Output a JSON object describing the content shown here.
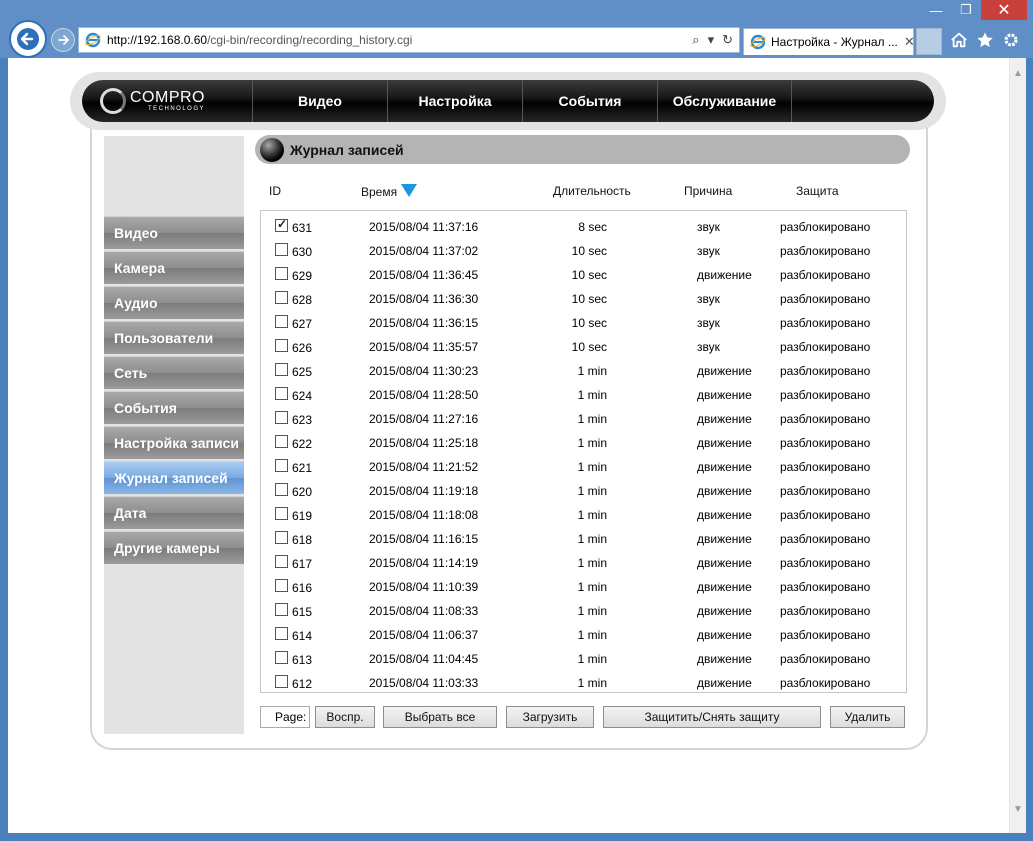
{
  "browser": {
    "url_host": "http://192.168.0.60",
    "url_path": "/cgi-bin/recording/recording_history.cgi",
    "tab_title": "Настройка - Журнал ...",
    "minimize": "—",
    "restore": "❐",
    "close": "✕",
    "tab_close": "✕"
  },
  "brand": {
    "name": "COMPRO",
    "sub": "TECHNOLOGY"
  },
  "topnav": [
    "Видео",
    "Настройка",
    "События",
    "Обслуживание"
  ],
  "sidebar": {
    "items": [
      {
        "label": "Видео",
        "active": false
      },
      {
        "label": "Камера",
        "active": false
      },
      {
        "label": "Аудио",
        "active": false
      },
      {
        "label": "Пользователи",
        "active": false
      },
      {
        "label": "Сеть",
        "active": false
      },
      {
        "label": "События",
        "active": false
      },
      {
        "label": "Настройка записи",
        "active": false
      },
      {
        "label": "Журнал записей",
        "active": true
      },
      {
        "label": "Дата",
        "active": false
      },
      {
        "label": "Другие камеры",
        "active": false
      }
    ]
  },
  "main": {
    "title": "Журнал записей",
    "columns": {
      "id": "ID",
      "time": "Время",
      "duration": "Длительность",
      "reason": "Причина",
      "protection": "Защита"
    },
    "rows": [
      {
        "checked": true,
        "id": "631",
        "time": "2015/08/04 11:37:16",
        "duration": "8 sec",
        "reason": "звук",
        "protection": "разблокировано"
      },
      {
        "checked": false,
        "id": "630",
        "time": "2015/08/04 11:37:02",
        "duration": "10 sec",
        "reason": "звук",
        "protection": "разблокировано"
      },
      {
        "checked": false,
        "id": "629",
        "time": "2015/08/04 11:36:45",
        "duration": "10 sec",
        "reason": "движение",
        "protection": "разблокировано"
      },
      {
        "checked": false,
        "id": "628",
        "time": "2015/08/04 11:36:30",
        "duration": "10 sec",
        "reason": "звук",
        "protection": "разблокировано"
      },
      {
        "checked": false,
        "id": "627",
        "time": "2015/08/04 11:36:15",
        "duration": "10 sec",
        "reason": "звук",
        "protection": "разблокировано"
      },
      {
        "checked": false,
        "id": "626",
        "time": "2015/08/04 11:35:57",
        "duration": "10 sec",
        "reason": "звук",
        "protection": "разблокировано"
      },
      {
        "checked": false,
        "id": "625",
        "time": "2015/08/04 11:30:23",
        "duration": "1 min",
        "reason": "движение",
        "protection": "разблокировано"
      },
      {
        "checked": false,
        "id": "624",
        "time": "2015/08/04 11:28:50",
        "duration": "1 min",
        "reason": "движение",
        "protection": "разблокировано"
      },
      {
        "checked": false,
        "id": "623",
        "time": "2015/08/04 11:27:16",
        "duration": "1 min",
        "reason": "движение",
        "protection": "разблокировано"
      },
      {
        "checked": false,
        "id": "622",
        "time": "2015/08/04 11:25:18",
        "duration": "1 min",
        "reason": "движение",
        "protection": "разблокировано"
      },
      {
        "checked": false,
        "id": "621",
        "time": "2015/08/04 11:21:52",
        "duration": "1 min",
        "reason": "движение",
        "protection": "разблокировано"
      },
      {
        "checked": false,
        "id": "620",
        "time": "2015/08/04 11:19:18",
        "duration": "1 min",
        "reason": "движение",
        "protection": "разблокировано"
      },
      {
        "checked": false,
        "id": "619",
        "time": "2015/08/04 11:18:08",
        "duration": "1 min",
        "reason": "движение",
        "protection": "разблокировано"
      },
      {
        "checked": false,
        "id": "618",
        "time": "2015/08/04 11:16:15",
        "duration": "1 min",
        "reason": "движение",
        "protection": "разблокировано"
      },
      {
        "checked": false,
        "id": "617",
        "time": "2015/08/04 11:14:19",
        "duration": "1 min",
        "reason": "движение",
        "protection": "разблокировано"
      },
      {
        "checked": false,
        "id": "616",
        "time": "2015/08/04 11:10:39",
        "duration": "1 min",
        "reason": "движение",
        "protection": "разблокировано"
      },
      {
        "checked": false,
        "id": "615",
        "time": "2015/08/04 11:08:33",
        "duration": "1 min",
        "reason": "движение",
        "protection": "разблокировано"
      },
      {
        "checked": false,
        "id": "614",
        "time": "2015/08/04 11:06:37",
        "duration": "1 min",
        "reason": "движение",
        "protection": "разблокировано"
      },
      {
        "checked": false,
        "id": "613",
        "time": "2015/08/04 11:04:45",
        "duration": "1 min",
        "reason": "движение",
        "protection": "разблокировано"
      },
      {
        "checked": false,
        "id": "612",
        "time": "2015/08/04 11:03:33",
        "duration": "1 min",
        "reason": "движение",
        "protection": "разблокировано"
      }
    ]
  },
  "toolbar": {
    "page_label": "Page:",
    "play": "Воспр.",
    "select_all": "Выбрать все",
    "download": "Загрузить",
    "protect": "Защитить/Снять защиту",
    "delete": "Удалить"
  },
  "colors": {
    "chrome": "#5f8fc6",
    "accent": "#1d95e0",
    "active_menu": "#79a9de",
    "menu": "#8d8d8d"
  }
}
